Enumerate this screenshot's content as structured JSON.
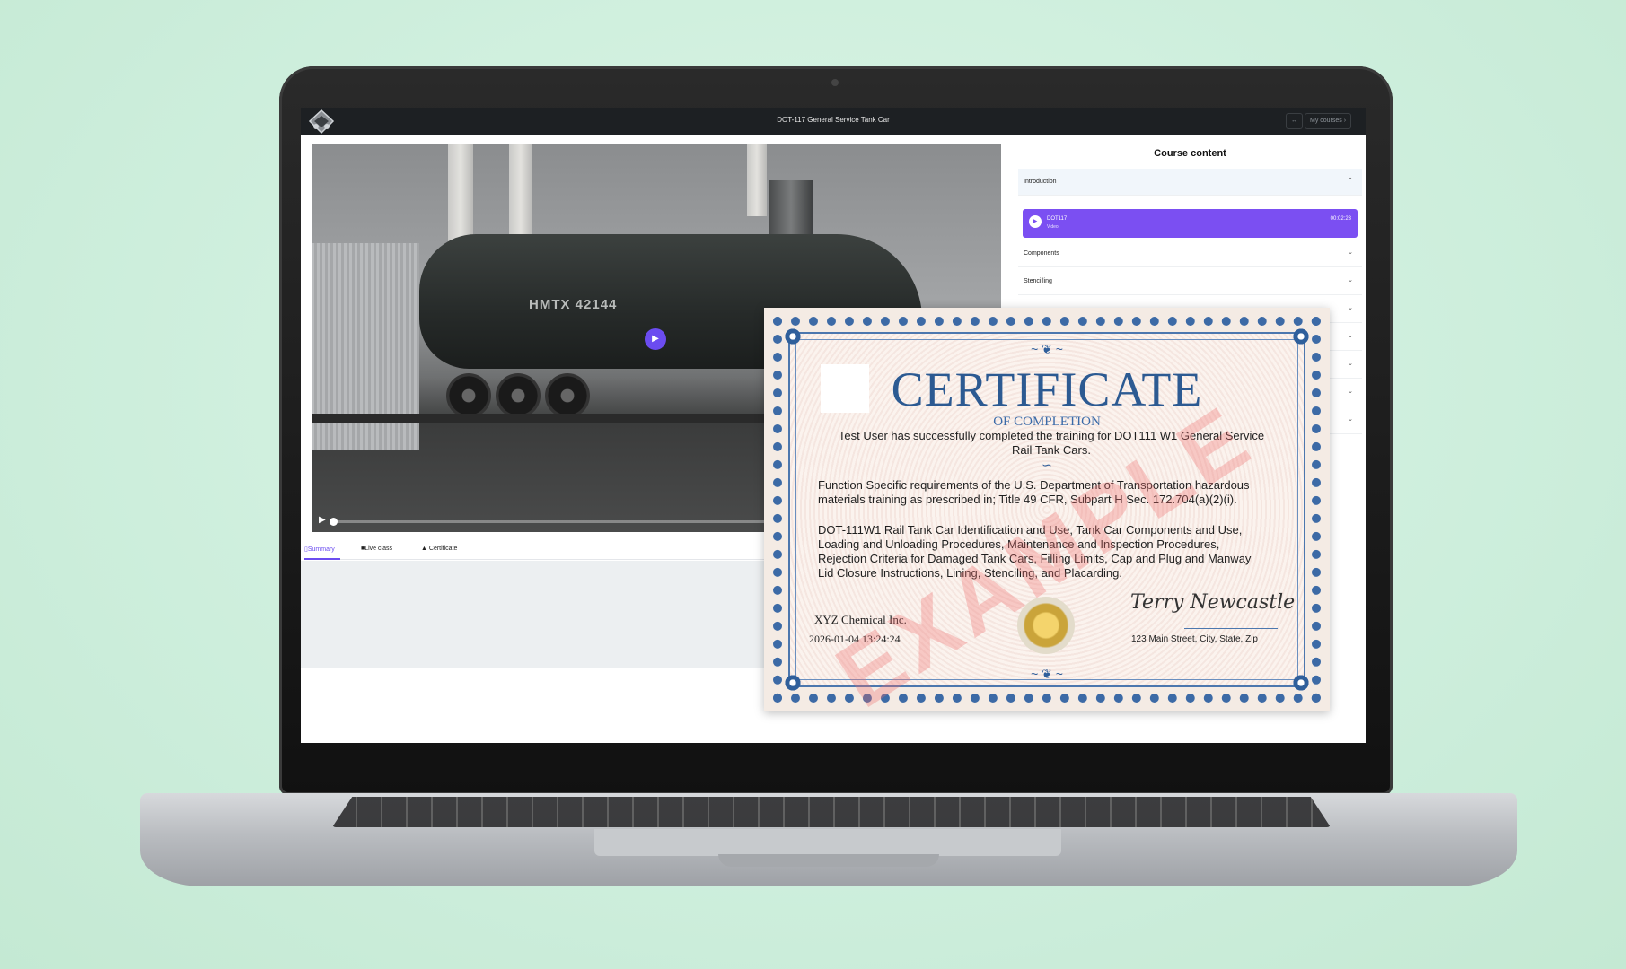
{
  "app": {
    "title": "DOT-117 General Service Tank Car",
    "my_courses_label": "My courses",
    "arrows_label": "↔"
  },
  "video": {
    "car_marking": "HMTX 42144",
    "play_icon": "play-icon"
  },
  "tabs": [
    {
      "label": "Summary",
      "icon": "bookmark-icon",
      "active": true
    },
    {
      "label": "Live class",
      "icon": "video-icon",
      "active": false
    },
    {
      "label": "Certificate",
      "icon": "graduation-cap-icon",
      "active": false
    }
  ],
  "sidebar": {
    "title": "Course content",
    "sections": [
      {
        "label": "Introduction",
        "expanded": true
      },
      {
        "label": "Components",
        "expanded": false
      },
      {
        "label": "Stencilling",
        "expanded": false
      }
    ],
    "active_lesson": {
      "name": "DOT117",
      "subtitle": "Video",
      "duration": "00:02:23"
    }
  },
  "certificate": {
    "title": "CERTIFICATE",
    "subtitle": "OF COMPLETION",
    "line1": "Test User has successfully completed the training for DOT111 W1 General Service",
    "line2": "Rail Tank Cars.",
    "para1_a": "Function Specific requirements of the U.S. Department of Transportation hazardous",
    "para1_b": "materials training as prescribed in; Title 49 CFR, Subpart H Sec. 172.704(a)(2)(i).",
    "para2_a": "DOT-111W1 Rail Tank Car Identification and Use, Tank Car Components and Use,",
    "para2_b": "Loading and Unloading Procedures, Maintenance and Inspection Procedures,",
    "para2_c": "Rejection Criteria for Damaged Tank Cars, Filling Limits, Cap and Plug and Manway",
    "para2_d": "Lid Closure Instructions, Lining, Stenciling, and Placarding.",
    "company": "XYZ Chemical Inc.",
    "date": "2026-01-04 13:24:24",
    "signature": "Terry Newcastle",
    "address": "123 Main Street, City, State, Zip",
    "watermark": "EXAMPLE"
  },
  "colors": {
    "accent": "#6b4cf0",
    "topbar": "#1d2023",
    "cert_blue": "#2c5a92"
  }
}
